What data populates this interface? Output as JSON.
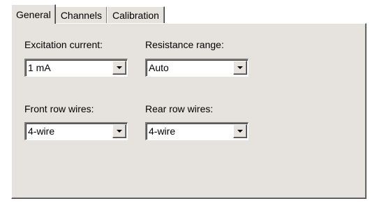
{
  "tabs": [
    {
      "label": "General",
      "active": true
    },
    {
      "label": "Channels",
      "active": false
    },
    {
      "label": "Calibration",
      "active": false
    }
  ],
  "fields": {
    "excitation_current": {
      "label": "Excitation current:",
      "value": "1 mA"
    },
    "resistance_range": {
      "label": "Resistance range:",
      "value": "Auto"
    },
    "front_row_wires": {
      "label": "Front row wires:",
      "value": "4-wire"
    },
    "rear_row_wires": {
      "label": "Rear row wires:",
      "value": "4-wire"
    }
  },
  "colors": {
    "face": "#e6e3df",
    "field_bg": "#ffffff"
  },
  "icons": {
    "dropdown": "chevron-down-icon"
  }
}
